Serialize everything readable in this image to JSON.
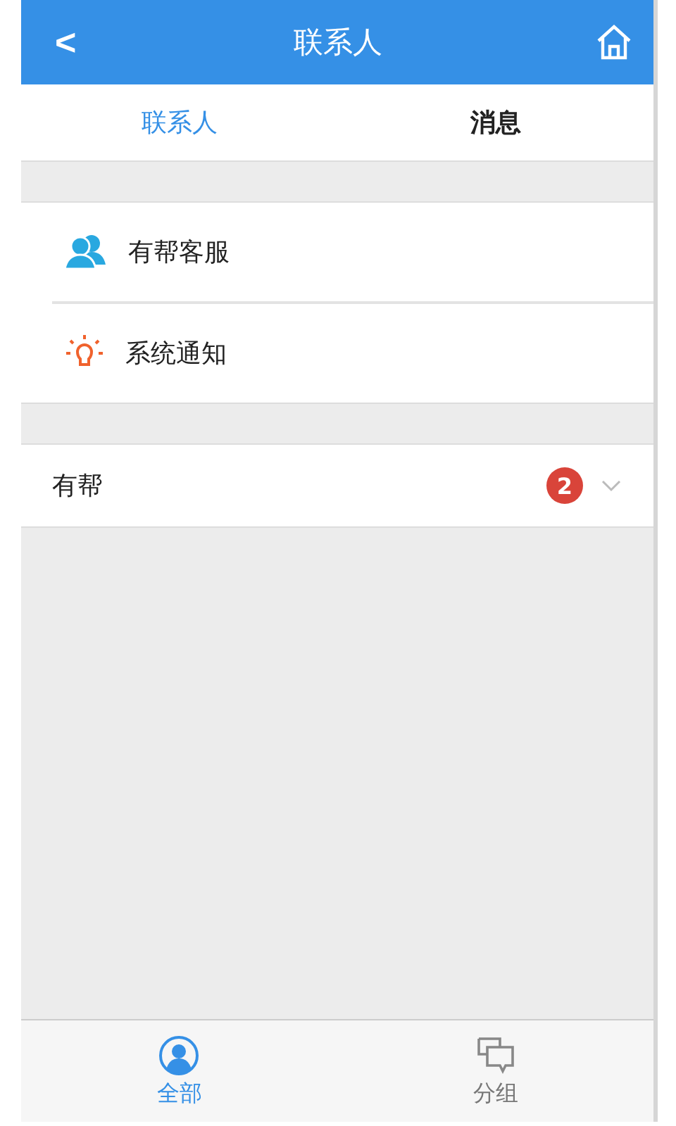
{
  "header": {
    "back": "<",
    "title": "联系人"
  },
  "tabs": [
    {
      "label": "联系人",
      "selected": true
    },
    {
      "label": "消息",
      "selected": false
    }
  ],
  "contacts": [
    {
      "kind": "service",
      "label": "有帮客服"
    },
    {
      "kind": "notice",
      "label": "系统通知"
    }
  ],
  "groups": [
    {
      "name": "有帮",
      "badge": "2",
      "expanded": false
    }
  ],
  "bottom_nav": [
    {
      "kind": "person",
      "label": "全部",
      "selected": true
    },
    {
      "kind": "chat",
      "label": "分组",
      "selected": false
    }
  ]
}
